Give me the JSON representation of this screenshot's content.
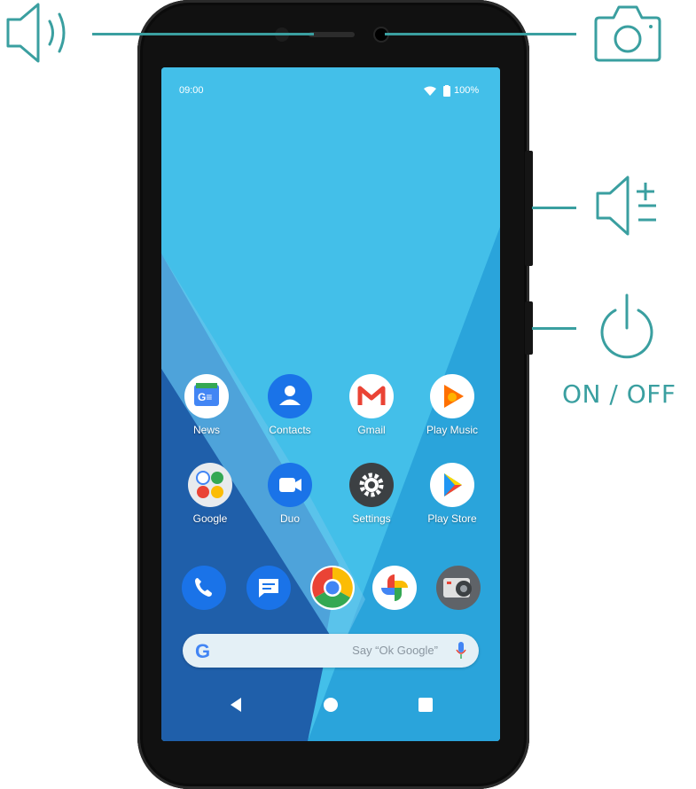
{
  "status_bar": {
    "time": "09:00",
    "battery": "100%"
  },
  "apps_row1": [
    {
      "label": "News",
      "icon": "news-icon"
    },
    {
      "label": "Contacts",
      "icon": "contacts-icon"
    },
    {
      "label": "Gmail",
      "icon": "gmail-icon"
    },
    {
      "label": "Play Music",
      "icon": "play-music-icon"
    }
  ],
  "apps_row2": [
    {
      "label": "Google",
      "icon": "google-folder-icon"
    },
    {
      "label": "Duo",
      "icon": "duo-icon"
    },
    {
      "label": "Settings",
      "icon": "settings-icon"
    },
    {
      "label": "Play Store",
      "icon": "play-store-icon"
    }
  ],
  "dock": [
    "phone-icon",
    "messages-icon",
    "chrome-icon",
    "photos-icon",
    "camera-icon"
  ],
  "search": {
    "logo": "G",
    "placeholder": "Say “Ok Google”"
  },
  "nav": [
    "back-icon",
    "home-icon",
    "recents-icon"
  ],
  "callouts": {
    "power_label": "ON / OFF",
    "accent": "#3a9fa0"
  }
}
